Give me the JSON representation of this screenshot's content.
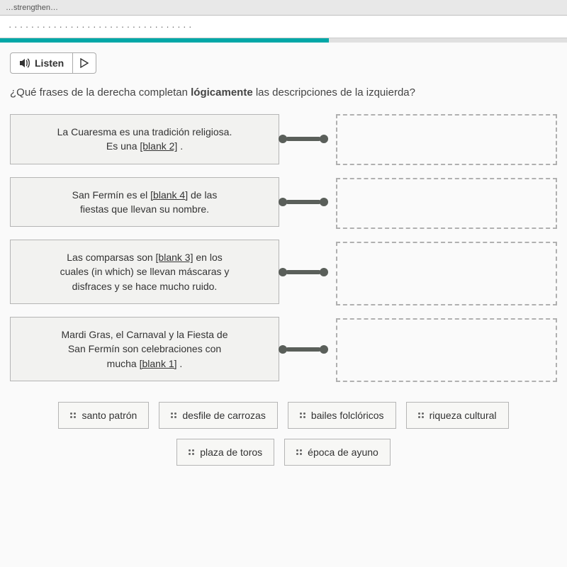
{
  "browser": {
    "url_fragment": "…strengthen…"
  },
  "header": {
    "truncated_title": "· · · · · · · · · · · ·  · · · · · ·  · · · · · · · ·  · · · · · · ·"
  },
  "listen": {
    "label": "Listen"
  },
  "prompt": {
    "prefix": "¿Qué frases de la derecha completan ",
    "strong": "lógicamente",
    "suffix": " las descripciones de la izquierda?"
  },
  "descriptions": [
    {
      "line1": "La Cuaresma es una tradición religiosa.",
      "line2_pre": "Es una ",
      "blank": "[blank 2]",
      "line2_post": " ."
    },
    {
      "line1_pre": "San Fermín es el ",
      "blank": "[blank 4]",
      "line1_post": " de las",
      "line2": "fiestas que llevan su nombre."
    },
    {
      "line1_pre": "Las comparsas son ",
      "blank": "[blank 3]",
      "line1_post": " en los",
      "line2": "cuales (in which) se llevan máscaras y",
      "line3": "disfraces y se hace mucho ruido."
    },
    {
      "line1": "Mardi Gras, el Carnaval y la Fiesta de",
      "line2": "San Fermín son celebraciones con",
      "line3_pre": "mucha ",
      "blank": "[blank 1]",
      "line3_post": " ."
    }
  ],
  "answers": [
    "santo patrón",
    "desfile de carrozas",
    "bailes folclóricos",
    "riqueza cultural",
    "plaza de toros",
    "época de ayuno"
  ]
}
